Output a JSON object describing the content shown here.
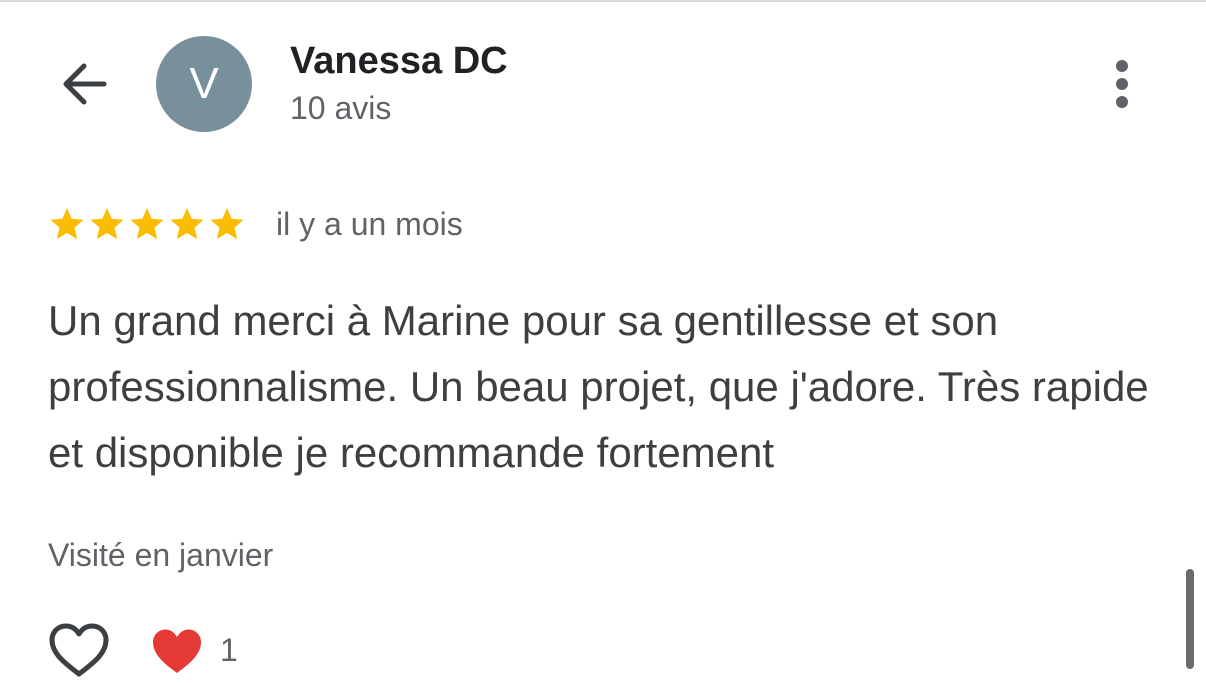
{
  "header": {
    "back_icon": "arrow-left-icon",
    "avatar_letter": "V",
    "avatar_color": "#78909c",
    "user_name": "Vanessa DC",
    "review_count": "10 avis",
    "more_icon": "more-vertical-icon"
  },
  "review": {
    "rating": 5,
    "rating_max": 5,
    "star_color": "#fbbc04",
    "date": "il y a un mois",
    "text": "Un grand merci à Marine pour sa gentillesse et son professionnalisme. Un beau projet, que j'adore. Très rapide et disponible je recommande fortement",
    "visit": "Visité en janvier"
  },
  "actions": {
    "like_icon": "heart-outline-icon",
    "reaction_icon": "red-heart-icon",
    "reaction_color": "#e53935",
    "reaction_count": "1"
  }
}
